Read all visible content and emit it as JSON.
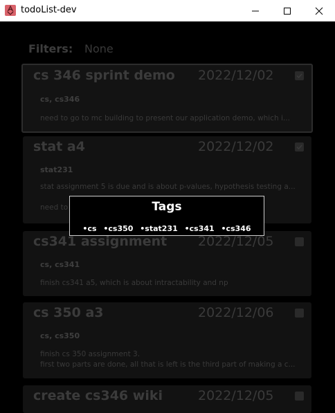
{
  "window": {
    "title": "todoList-dev"
  },
  "filters": {
    "label": "Filters:",
    "value": "None"
  },
  "cards": [
    {
      "title": "cs 346 sprint demo",
      "date": "2022/12/02",
      "tags": "cs, cs346",
      "checked": true,
      "description": "need to go to mc building to present our application demo, which i..."
    },
    {
      "title": "stat a4",
      "date": "2022/12/02",
      "tags": "stat231",
      "checked": true,
      "description": "stat assignment 5 is due and is about p-values, hypothesis testing a...\n\nneed to"
    },
    {
      "title": "cs341 assignment",
      "date": "2022/12/05",
      "tags": "cs, cs341",
      "checked": false,
      "description": "finish cs341 a5, which is about intractability and np"
    },
    {
      "title": "cs 350 a3",
      "date": "2022/12/06",
      "tags": "cs, cs350",
      "checked": false,
      "description": "finish cs 350 assignment 3.\nfirst two parts are done, all that is left is the third part of making a c..."
    },
    {
      "title": "create cs346 wiki",
      "date": "2022/12/05",
      "tags": "",
      "checked": false,
      "description": ""
    }
  ],
  "tags_popup": {
    "title": "Tags",
    "tags": [
      "•cs",
      "•cs350",
      "•stat231",
      "•cs341",
      "•cs346"
    ]
  }
}
